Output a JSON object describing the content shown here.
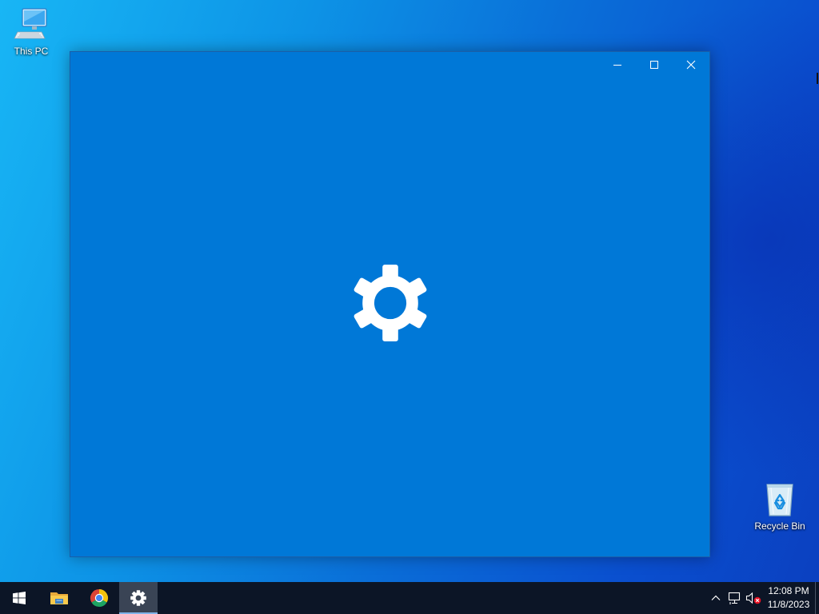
{
  "desktop": {
    "icons": [
      {
        "label": "This PC",
        "icon": "this-pc-icon"
      },
      {
        "label": "Recycle Bin",
        "icon": "recycle-bin-icon"
      }
    ]
  },
  "window": {
    "app": "Settings",
    "state": "loading-splash",
    "splash_icon": "gear-icon",
    "background_color": "#0078d7",
    "controls": [
      {
        "name": "minimize",
        "icon": "minimize-icon"
      },
      {
        "name": "maximize",
        "icon": "maximize-icon"
      },
      {
        "name": "close",
        "icon": "close-icon"
      }
    ]
  },
  "taskbar": {
    "background_color": "#0c1526",
    "buttons": [
      {
        "name": "start",
        "icon": "windows-logo-icon",
        "active": false
      },
      {
        "name": "file-explorer",
        "icon": "folder-icon",
        "active": false
      },
      {
        "name": "google-chrome",
        "icon": "chrome-icon",
        "active": false
      },
      {
        "name": "settings",
        "icon": "gear-icon",
        "active": true
      }
    ],
    "tray": {
      "icons": [
        "chevron-up-icon",
        "network-icon",
        "volume-muted-icon"
      ],
      "time": "12:08 PM",
      "date": "11/8/2023"
    }
  }
}
